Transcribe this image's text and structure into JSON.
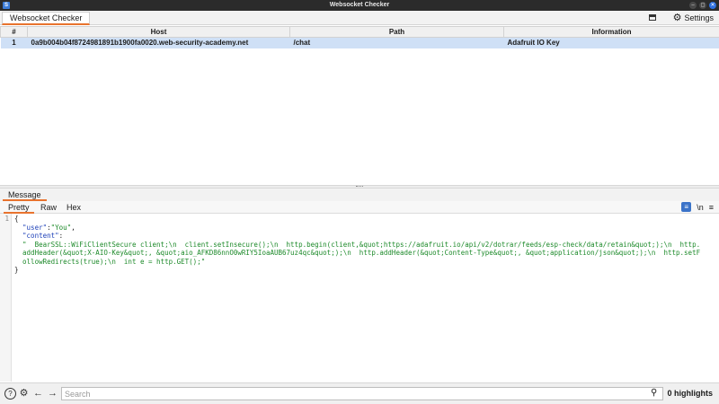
{
  "window": {
    "title": "Websocket Checker",
    "app_icon": "S"
  },
  "tabbar": {
    "tab_label": "Websocket Checker",
    "settings_label": "Settings"
  },
  "table": {
    "columns": [
      "#",
      "Host",
      "Path",
      "Information"
    ],
    "rows": [
      {
        "num": "1",
        "host": "0a9b004b04f8724981891b1900fa0020.web-security-academy.net",
        "path": "/chat",
        "info": "Adafruit IO Key"
      }
    ]
  },
  "message": {
    "header_label": "Message",
    "subtabs": [
      "Pretty",
      "Raw",
      "Hex"
    ],
    "active_subtab": "Pretty",
    "newline_toggle": "\\n",
    "menu_glyph": "≡",
    "gutter_number": "1",
    "code": {
      "open_brace": "{",
      "user_key": "\"user\"",
      "user_value": "\"You\"",
      "content_key": "\"content\"",
      "content_line1": "\"  BearSSL::WiFiClientSecure client;\\n  client.setInsecure();\\n  http.begin(client,&quot;https://adafruit.io/api/v2/dotrar/feeds/esp-check/data/retain&quot;);\\n  http.",
      "content_line2": "addHeader(&quot;X-AIO-Key&quot;, &quot;aio_AFKD86nnO0wRIY5IoaAUB67uz4qc&quot;);\\n  http.addHeader(&quot;Content-Type&quot;, &quot;application/json&quot;);\\n  http.setF",
      "content_line3": "ollowRedirects(true);\\n  int e = http.GET();\"",
      "close_brace": "}"
    }
  },
  "searchbar": {
    "placeholder": "Search",
    "highlights": "0 highlights"
  }
}
